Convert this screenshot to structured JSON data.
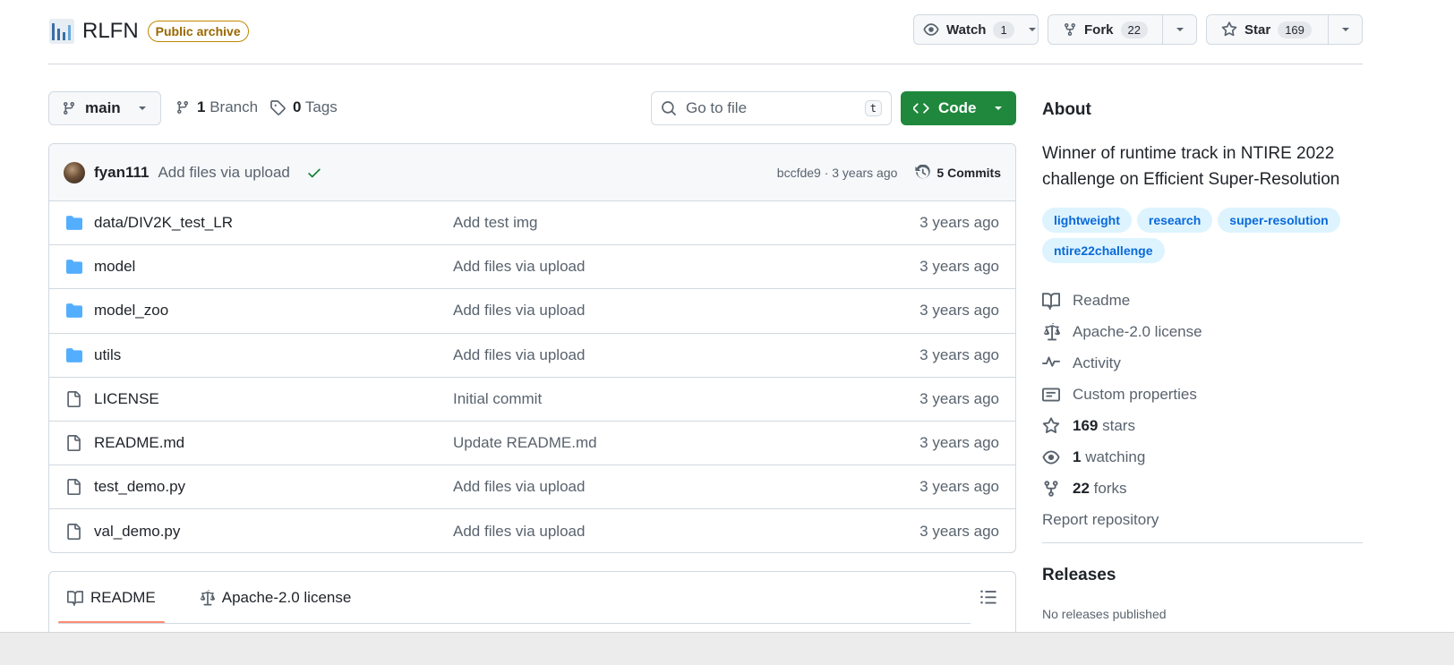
{
  "repo": {
    "name": "RLFN",
    "badge": "Public archive"
  },
  "header_actions": {
    "watch": {
      "label": "Watch",
      "count": "1"
    },
    "fork": {
      "label": "Fork",
      "count": "22"
    },
    "star": {
      "label": "Star",
      "count": "169"
    }
  },
  "toolbar": {
    "branch": "main",
    "branches_count": "1",
    "branches_label": "Branch",
    "tags_count": "0",
    "tags_label": "Tags",
    "goto_placeholder": "Go to file",
    "goto_shortcut": "t",
    "code_label": "Code"
  },
  "latest_commit": {
    "author": "fyan111",
    "message": "Add files via upload",
    "meta": "bccfde9 · 3 years ago",
    "commits_label": "5 Commits"
  },
  "files": [
    {
      "type": "folder",
      "name": "data/DIV2K_test_LR",
      "message": "Add test img",
      "date": "3 years ago"
    },
    {
      "type": "folder",
      "name": "model",
      "message": "Add files via upload",
      "date": "3 years ago"
    },
    {
      "type": "folder",
      "name": "model_zoo",
      "message": "Add files via upload",
      "date": "3 years ago"
    },
    {
      "type": "folder",
      "name": "utils",
      "message": "Add files via upload",
      "date": "3 years ago"
    },
    {
      "type": "file",
      "name": "LICENSE",
      "message": "Initial commit",
      "date": "3 years ago"
    },
    {
      "type": "file",
      "name": "README.md",
      "message": "Update README.md",
      "date": "3 years ago"
    },
    {
      "type": "file",
      "name": "test_demo.py",
      "message": "Add files via upload",
      "date": "3 years ago"
    },
    {
      "type": "file",
      "name": "val_demo.py",
      "message": "Add files via upload",
      "date": "3 years ago"
    }
  ],
  "readme_tabs": {
    "readme": "README",
    "license": "Apache-2.0 license"
  },
  "about": {
    "title": "About",
    "description": "Winner of runtime track in NTIRE 2022 challenge on Efficient Super-Resolution",
    "topics": [
      "lightweight",
      "research",
      "super-resolution",
      "ntire22challenge"
    ],
    "readme": "Readme",
    "license": "Apache-2.0 license",
    "activity": "Activity",
    "custom_properties": "Custom properties",
    "stars_count": "169",
    "stars_label": "stars",
    "watching_count": "1",
    "watching_label": "watching",
    "forks_count": "22",
    "forks_label": "forks",
    "report": "Report repository"
  },
  "releases": {
    "title": "Releases",
    "empty": "No releases published"
  },
  "colors": {
    "accent_green": "#1f883d",
    "link_blue": "#0969da",
    "archive_badge": "#9a6700",
    "folder_blue": "#54aeff",
    "tab_underline": "#fd8c73"
  }
}
